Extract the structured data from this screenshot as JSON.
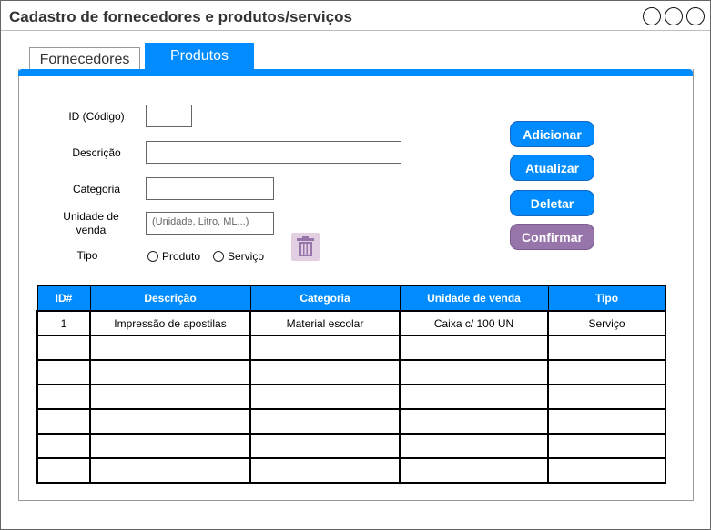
{
  "window": {
    "title": "Cadastro de fornecedores e produtos/serviços"
  },
  "tabs": [
    {
      "label": "Fornecedores",
      "active": false
    },
    {
      "label": "Produtos",
      "active": true
    }
  ],
  "form": {
    "id_label": "ID (Código)",
    "descricao_label": "Descrição",
    "categoria_label": "Categoria",
    "unidade_label_1": "Unidade de",
    "unidade_label_2": "venda",
    "unidade_placeholder": "(Unidade, Litro, ML...)",
    "tipo_label": "Tipo",
    "tipo_options": [
      "Produto",
      "Serviço"
    ]
  },
  "buttons": {
    "adicionar": "Adicionar",
    "atualizar": "Atualizar",
    "deletar": "Deletar",
    "confirmar": "Confirmar"
  },
  "table": {
    "columns": [
      "ID#",
      "Descrição",
      "Categoria",
      "Unidade de venda",
      "Tipo"
    ],
    "rows": [
      [
        "1",
        "Impressão de apostilas",
        "Material escolar",
        "Caixa c/ 100 UN",
        "Serviço"
      ],
      [
        "",
        "",
        "",
        "",
        ""
      ],
      [
        "",
        "",
        "",
        "",
        ""
      ],
      [
        "",
        "",
        "",
        "",
        ""
      ],
      [
        "",
        "",
        "",
        "",
        ""
      ],
      [
        "",
        "",
        "",
        "",
        ""
      ],
      [
        "",
        "",
        "",
        "",
        ""
      ]
    ]
  },
  "colors": {
    "accent": "#008cff",
    "confirm": "#9775ab",
    "trash_bg": "#e2cfe2",
    "trash_icon": "#9775ab"
  },
  "icons": {
    "window_controls": [
      "circle-icon",
      "circle-icon",
      "circle-icon"
    ],
    "delete": "trash-icon"
  }
}
